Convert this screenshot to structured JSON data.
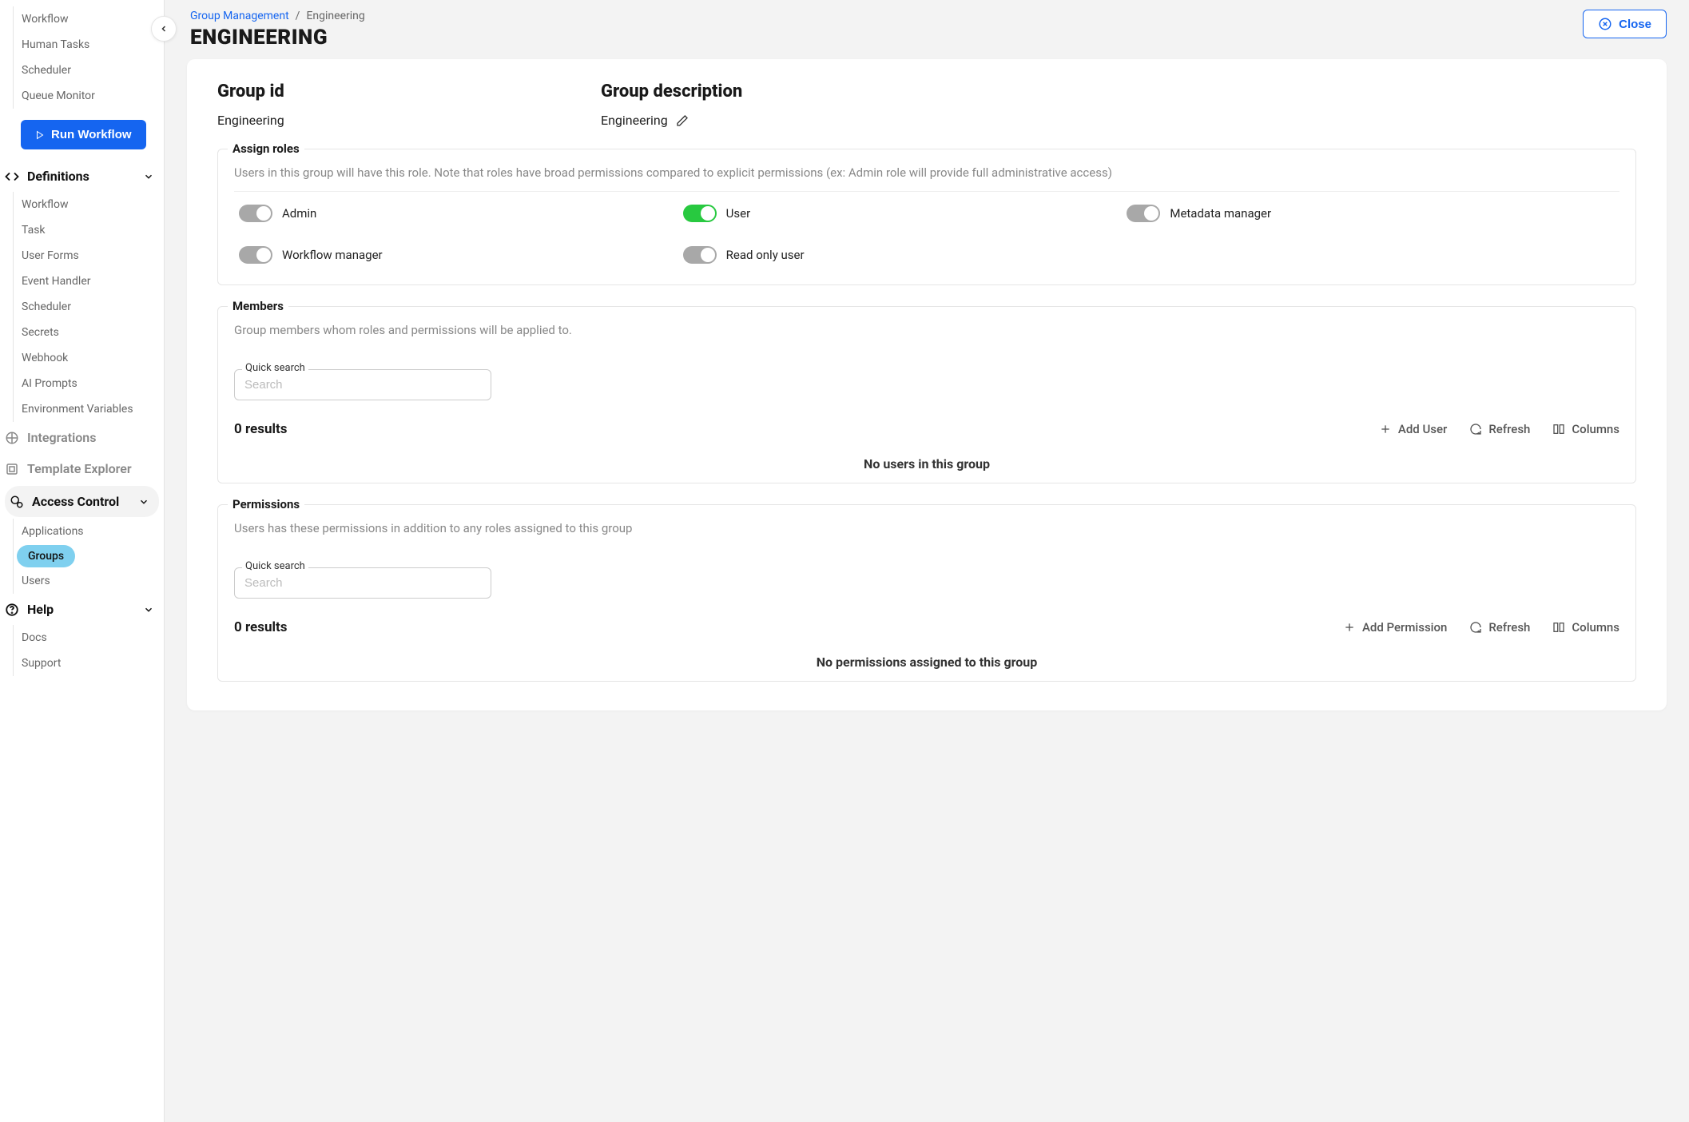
{
  "sidebar": {
    "top_items": [
      "Workflow",
      "Human Tasks",
      "Scheduler",
      "Queue Monitor"
    ],
    "run_btn": "Run Workflow",
    "definitions": {
      "label": "Definitions",
      "items": [
        "Workflow",
        "Task",
        "User Forms",
        "Event Handler",
        "Scheduler",
        "Secrets",
        "Webhook",
        "AI Prompts",
        "Environment Variables"
      ]
    },
    "integrations": "Integrations",
    "template_explorer": "Template Explorer",
    "access_control": {
      "label": "Access Control",
      "items": [
        "Applications",
        "Groups",
        "Users"
      ],
      "active": "Groups"
    },
    "help": {
      "label": "Help",
      "items": [
        "Docs",
        "Support"
      ]
    }
  },
  "breadcrumb": {
    "root": "Group Management",
    "current": "Engineering"
  },
  "page_title": "ENGINEERING",
  "close_label": "Close",
  "group_id": {
    "label": "Group id",
    "value": "Engineering"
  },
  "group_desc": {
    "label": "Group description",
    "value": "Engineering"
  },
  "assign_roles": {
    "title": "Assign roles",
    "desc": "Users in this group will have this role. Note that roles have broad permissions compared to explicit permissions (ex: Admin role will provide full administrative access)",
    "roles": [
      {
        "label": "Admin",
        "on": false,
        "knob_right": true
      },
      {
        "label": "User",
        "on": true
      },
      {
        "label": "Metadata manager",
        "on": false,
        "knob_right": true
      },
      {
        "label": "Workflow manager",
        "on": false,
        "knob_right": true
      },
      {
        "label": "Read only user",
        "on": false,
        "knob_right": true
      }
    ]
  },
  "members": {
    "title": "Members",
    "desc": "Group members whom roles and permissions will be applied to.",
    "quick_search": "Quick search",
    "placeholder": "Search",
    "results": "0 results",
    "add_label": "Add User",
    "refresh": "Refresh",
    "columns": "Columns",
    "empty": "No users in this group"
  },
  "permissions": {
    "title": "Permissions",
    "desc": "Users has these permissions in addition to any roles assigned to this group",
    "quick_search": "Quick search",
    "placeholder": "Search",
    "results": "0 results",
    "add_label": "Add Permission",
    "refresh": "Refresh",
    "columns": "Columns",
    "empty": "No permissions assigned to this group"
  }
}
